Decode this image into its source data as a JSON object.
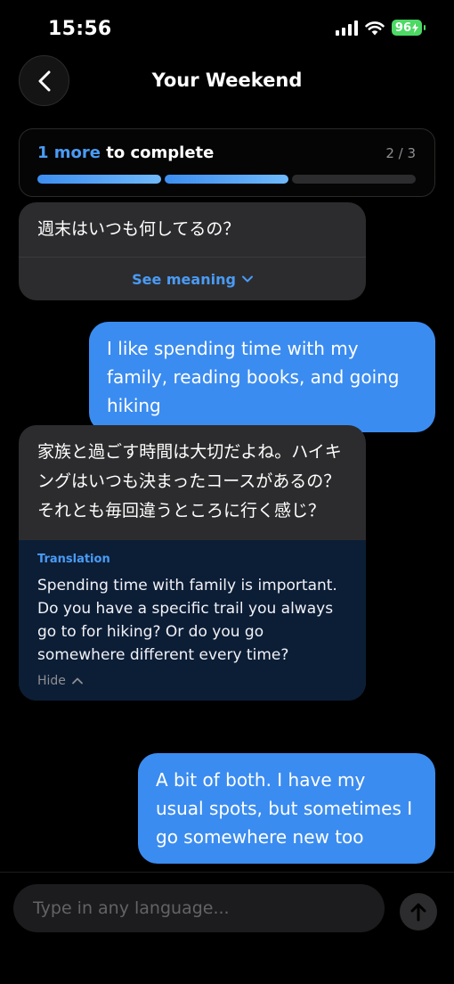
{
  "status_bar": {
    "time": "15:56",
    "battery": "96"
  },
  "header": {
    "title": "Your Weekend",
    "back_icon": "chevron-left-icon"
  },
  "progress": {
    "accent_text": "1 more",
    "rest_text": " to complete",
    "count": "2 / 3",
    "completed": 2,
    "total": 3
  },
  "messages": [
    {
      "role": "assistant",
      "text": "週末はいつも何してるの？",
      "action_label": "See meaning"
    },
    {
      "role": "user",
      "text": "I like spending time with my family, reading books, and going hiking"
    },
    {
      "role": "assistant",
      "text": "家族と過ごす時間は大切だよね。ハイキングはいつも決まったコースがあるの？それとも毎回違うところに行く感じ？",
      "translation_label": "Translation",
      "translation": "Spending time with family is important. Do you have a specific trail you always go to for hiking? Or do you go somewhere different every time?",
      "hide_label": "Hide"
    },
    {
      "role": "user",
      "text": "A bit of both. I have my usual spots, but sometimes I go somewhere new too"
    }
  ],
  "composer": {
    "placeholder": "Type in any language..."
  },
  "colors": {
    "accent": "#4a9bf5",
    "user_bubble": "#3b8cf0",
    "ai_bubble": "#2c2c2e",
    "translation_bg": "#0c1e36",
    "battery": "#4cd964"
  }
}
